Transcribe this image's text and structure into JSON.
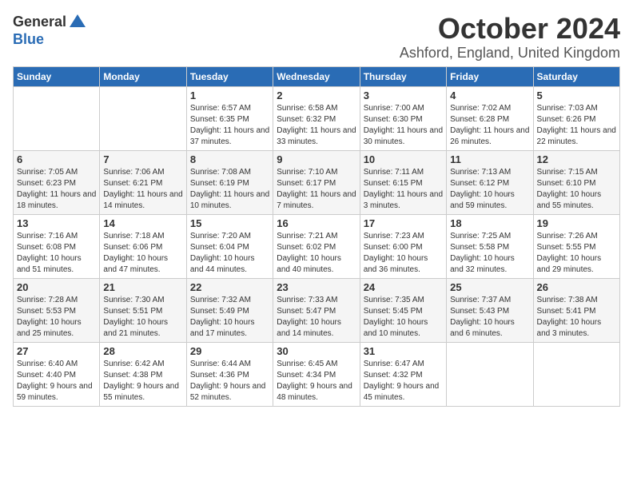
{
  "logo": {
    "general": "General",
    "blue": "Blue"
  },
  "title": "October 2024",
  "location": "Ashford, England, United Kingdom",
  "days_of_week": [
    "Sunday",
    "Monday",
    "Tuesday",
    "Wednesday",
    "Thursday",
    "Friday",
    "Saturday"
  ],
  "weeks": [
    [
      {
        "day": "",
        "info": ""
      },
      {
        "day": "",
        "info": ""
      },
      {
        "day": "1",
        "info": "Sunrise: 6:57 AM\nSunset: 6:35 PM\nDaylight: 11 hours and 37 minutes."
      },
      {
        "day": "2",
        "info": "Sunrise: 6:58 AM\nSunset: 6:32 PM\nDaylight: 11 hours and 33 minutes."
      },
      {
        "day": "3",
        "info": "Sunrise: 7:00 AM\nSunset: 6:30 PM\nDaylight: 11 hours and 30 minutes."
      },
      {
        "day": "4",
        "info": "Sunrise: 7:02 AM\nSunset: 6:28 PM\nDaylight: 11 hours and 26 minutes."
      },
      {
        "day": "5",
        "info": "Sunrise: 7:03 AM\nSunset: 6:26 PM\nDaylight: 11 hours and 22 minutes."
      }
    ],
    [
      {
        "day": "6",
        "info": "Sunrise: 7:05 AM\nSunset: 6:23 PM\nDaylight: 11 hours and 18 minutes."
      },
      {
        "day": "7",
        "info": "Sunrise: 7:06 AM\nSunset: 6:21 PM\nDaylight: 11 hours and 14 minutes."
      },
      {
        "day": "8",
        "info": "Sunrise: 7:08 AM\nSunset: 6:19 PM\nDaylight: 11 hours and 10 minutes."
      },
      {
        "day": "9",
        "info": "Sunrise: 7:10 AM\nSunset: 6:17 PM\nDaylight: 11 hours and 7 minutes."
      },
      {
        "day": "10",
        "info": "Sunrise: 7:11 AM\nSunset: 6:15 PM\nDaylight: 11 hours and 3 minutes."
      },
      {
        "day": "11",
        "info": "Sunrise: 7:13 AM\nSunset: 6:12 PM\nDaylight: 10 hours and 59 minutes."
      },
      {
        "day": "12",
        "info": "Sunrise: 7:15 AM\nSunset: 6:10 PM\nDaylight: 10 hours and 55 minutes."
      }
    ],
    [
      {
        "day": "13",
        "info": "Sunrise: 7:16 AM\nSunset: 6:08 PM\nDaylight: 10 hours and 51 minutes."
      },
      {
        "day": "14",
        "info": "Sunrise: 7:18 AM\nSunset: 6:06 PM\nDaylight: 10 hours and 47 minutes."
      },
      {
        "day": "15",
        "info": "Sunrise: 7:20 AM\nSunset: 6:04 PM\nDaylight: 10 hours and 44 minutes."
      },
      {
        "day": "16",
        "info": "Sunrise: 7:21 AM\nSunset: 6:02 PM\nDaylight: 10 hours and 40 minutes."
      },
      {
        "day": "17",
        "info": "Sunrise: 7:23 AM\nSunset: 6:00 PM\nDaylight: 10 hours and 36 minutes."
      },
      {
        "day": "18",
        "info": "Sunrise: 7:25 AM\nSunset: 5:58 PM\nDaylight: 10 hours and 32 minutes."
      },
      {
        "day": "19",
        "info": "Sunrise: 7:26 AM\nSunset: 5:55 PM\nDaylight: 10 hours and 29 minutes."
      }
    ],
    [
      {
        "day": "20",
        "info": "Sunrise: 7:28 AM\nSunset: 5:53 PM\nDaylight: 10 hours and 25 minutes."
      },
      {
        "day": "21",
        "info": "Sunrise: 7:30 AM\nSunset: 5:51 PM\nDaylight: 10 hours and 21 minutes."
      },
      {
        "day": "22",
        "info": "Sunrise: 7:32 AM\nSunset: 5:49 PM\nDaylight: 10 hours and 17 minutes."
      },
      {
        "day": "23",
        "info": "Sunrise: 7:33 AM\nSunset: 5:47 PM\nDaylight: 10 hours and 14 minutes."
      },
      {
        "day": "24",
        "info": "Sunrise: 7:35 AM\nSunset: 5:45 PM\nDaylight: 10 hours and 10 minutes."
      },
      {
        "day": "25",
        "info": "Sunrise: 7:37 AM\nSunset: 5:43 PM\nDaylight: 10 hours and 6 minutes."
      },
      {
        "day": "26",
        "info": "Sunrise: 7:38 AM\nSunset: 5:41 PM\nDaylight: 10 hours and 3 minutes."
      }
    ],
    [
      {
        "day": "27",
        "info": "Sunrise: 6:40 AM\nSunset: 4:40 PM\nDaylight: 9 hours and 59 minutes."
      },
      {
        "day": "28",
        "info": "Sunrise: 6:42 AM\nSunset: 4:38 PM\nDaylight: 9 hours and 55 minutes."
      },
      {
        "day": "29",
        "info": "Sunrise: 6:44 AM\nSunset: 4:36 PM\nDaylight: 9 hours and 52 minutes."
      },
      {
        "day": "30",
        "info": "Sunrise: 6:45 AM\nSunset: 4:34 PM\nDaylight: 9 hours and 48 minutes."
      },
      {
        "day": "31",
        "info": "Sunrise: 6:47 AM\nSunset: 4:32 PM\nDaylight: 9 hours and 45 minutes."
      },
      {
        "day": "",
        "info": ""
      },
      {
        "day": "",
        "info": ""
      }
    ]
  ]
}
